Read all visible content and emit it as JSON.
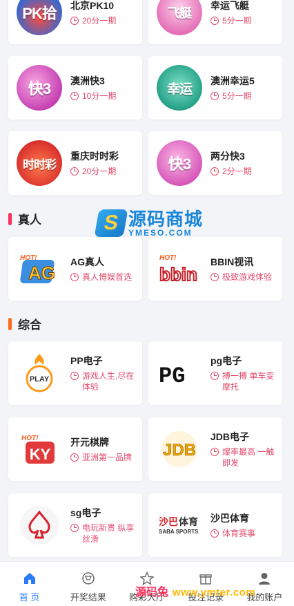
{
  "lottery": [
    {
      "title": "北京PK10",
      "sub": "20分一期",
      "icon": "pk10-icon",
      "glyph": "PK拾"
    },
    {
      "title": "幸运飞艇",
      "sub": "5分一期",
      "icon": "airship-icon",
      "glyph": "飞艇"
    },
    {
      "title": "澳洲快3",
      "sub": "10分一期",
      "icon": "dice-k3-icon",
      "glyph": "快3"
    },
    {
      "title": "澳洲幸运5",
      "sub": "5分一期",
      "icon": "lucky5-ball-icon",
      "glyph": "幸运"
    },
    {
      "title": "重庆时时彩",
      "sub": "20分一期",
      "icon": "ssc-dice-icon",
      "glyph": "时时彩"
    },
    {
      "title": "两分快3",
      "sub": "2分一期",
      "icon": "dice-k3-icon",
      "glyph": "快3"
    }
  ],
  "sections": {
    "live": "真人",
    "misc": "综合"
  },
  "live": [
    {
      "title": "AG真人",
      "sub": "真人博娱首选",
      "icon": "ag-logo-icon",
      "glyph": "AG"
    },
    {
      "title": "BBIN视讯",
      "sub": "极致游戏体验",
      "icon": "bbin-logo-icon",
      "glyph": "bbin"
    }
  ],
  "misc": [
    {
      "title": "PP电子",
      "sub": "游戏人生,尽在体验",
      "icon": "pp-play-logo-icon",
      "glyph": "PLAY"
    },
    {
      "title": "pg电子",
      "sub": "搏一搏 单车变摩托",
      "icon": "pg-logo-icon",
      "glyph": "PG"
    },
    {
      "title": "开元棋牌",
      "sub": "亚洲第一品牌",
      "icon": "ky-logo-icon",
      "glyph": "KY"
    },
    {
      "title": "JDB电子",
      "sub": "爆率最高 一触即发",
      "icon": "jdb-logo-icon",
      "glyph": "JDB"
    },
    {
      "title": "sg电子",
      "sub": "电玩新贵 纵享丝滑",
      "icon": "spade-logo-icon",
      "glyph": "♠"
    },
    {
      "title": "沙巴体育",
      "sub": "体育赛事",
      "icon": "saba-logo-icon",
      "glyph": "沙巴体育"
    }
  ],
  "watermark": {
    "cn": "源码商城",
    "en": "YMESO.COM",
    "s": "S"
  },
  "footer_watermark": {
    "cn": "源码兔",
    "url": "www.ymter.com"
  },
  "tabs": [
    {
      "label": "首 页",
      "icon": "home-icon",
      "active": true
    },
    {
      "label": "开奖结果",
      "icon": "trophy-icon",
      "active": false
    },
    {
      "label": "购彩大厅",
      "icon": "star-icon",
      "active": false
    },
    {
      "label": "投注记录",
      "icon": "gift-icon",
      "active": false
    },
    {
      "label": "我的账户",
      "icon": "user-icon",
      "active": false
    }
  ],
  "colors": {
    "accent": "#2a7cf6",
    "subtitle": "#e24a6a",
    "live_bar": "#ff2f5c",
    "misc_bar": "#ff6a1a"
  }
}
